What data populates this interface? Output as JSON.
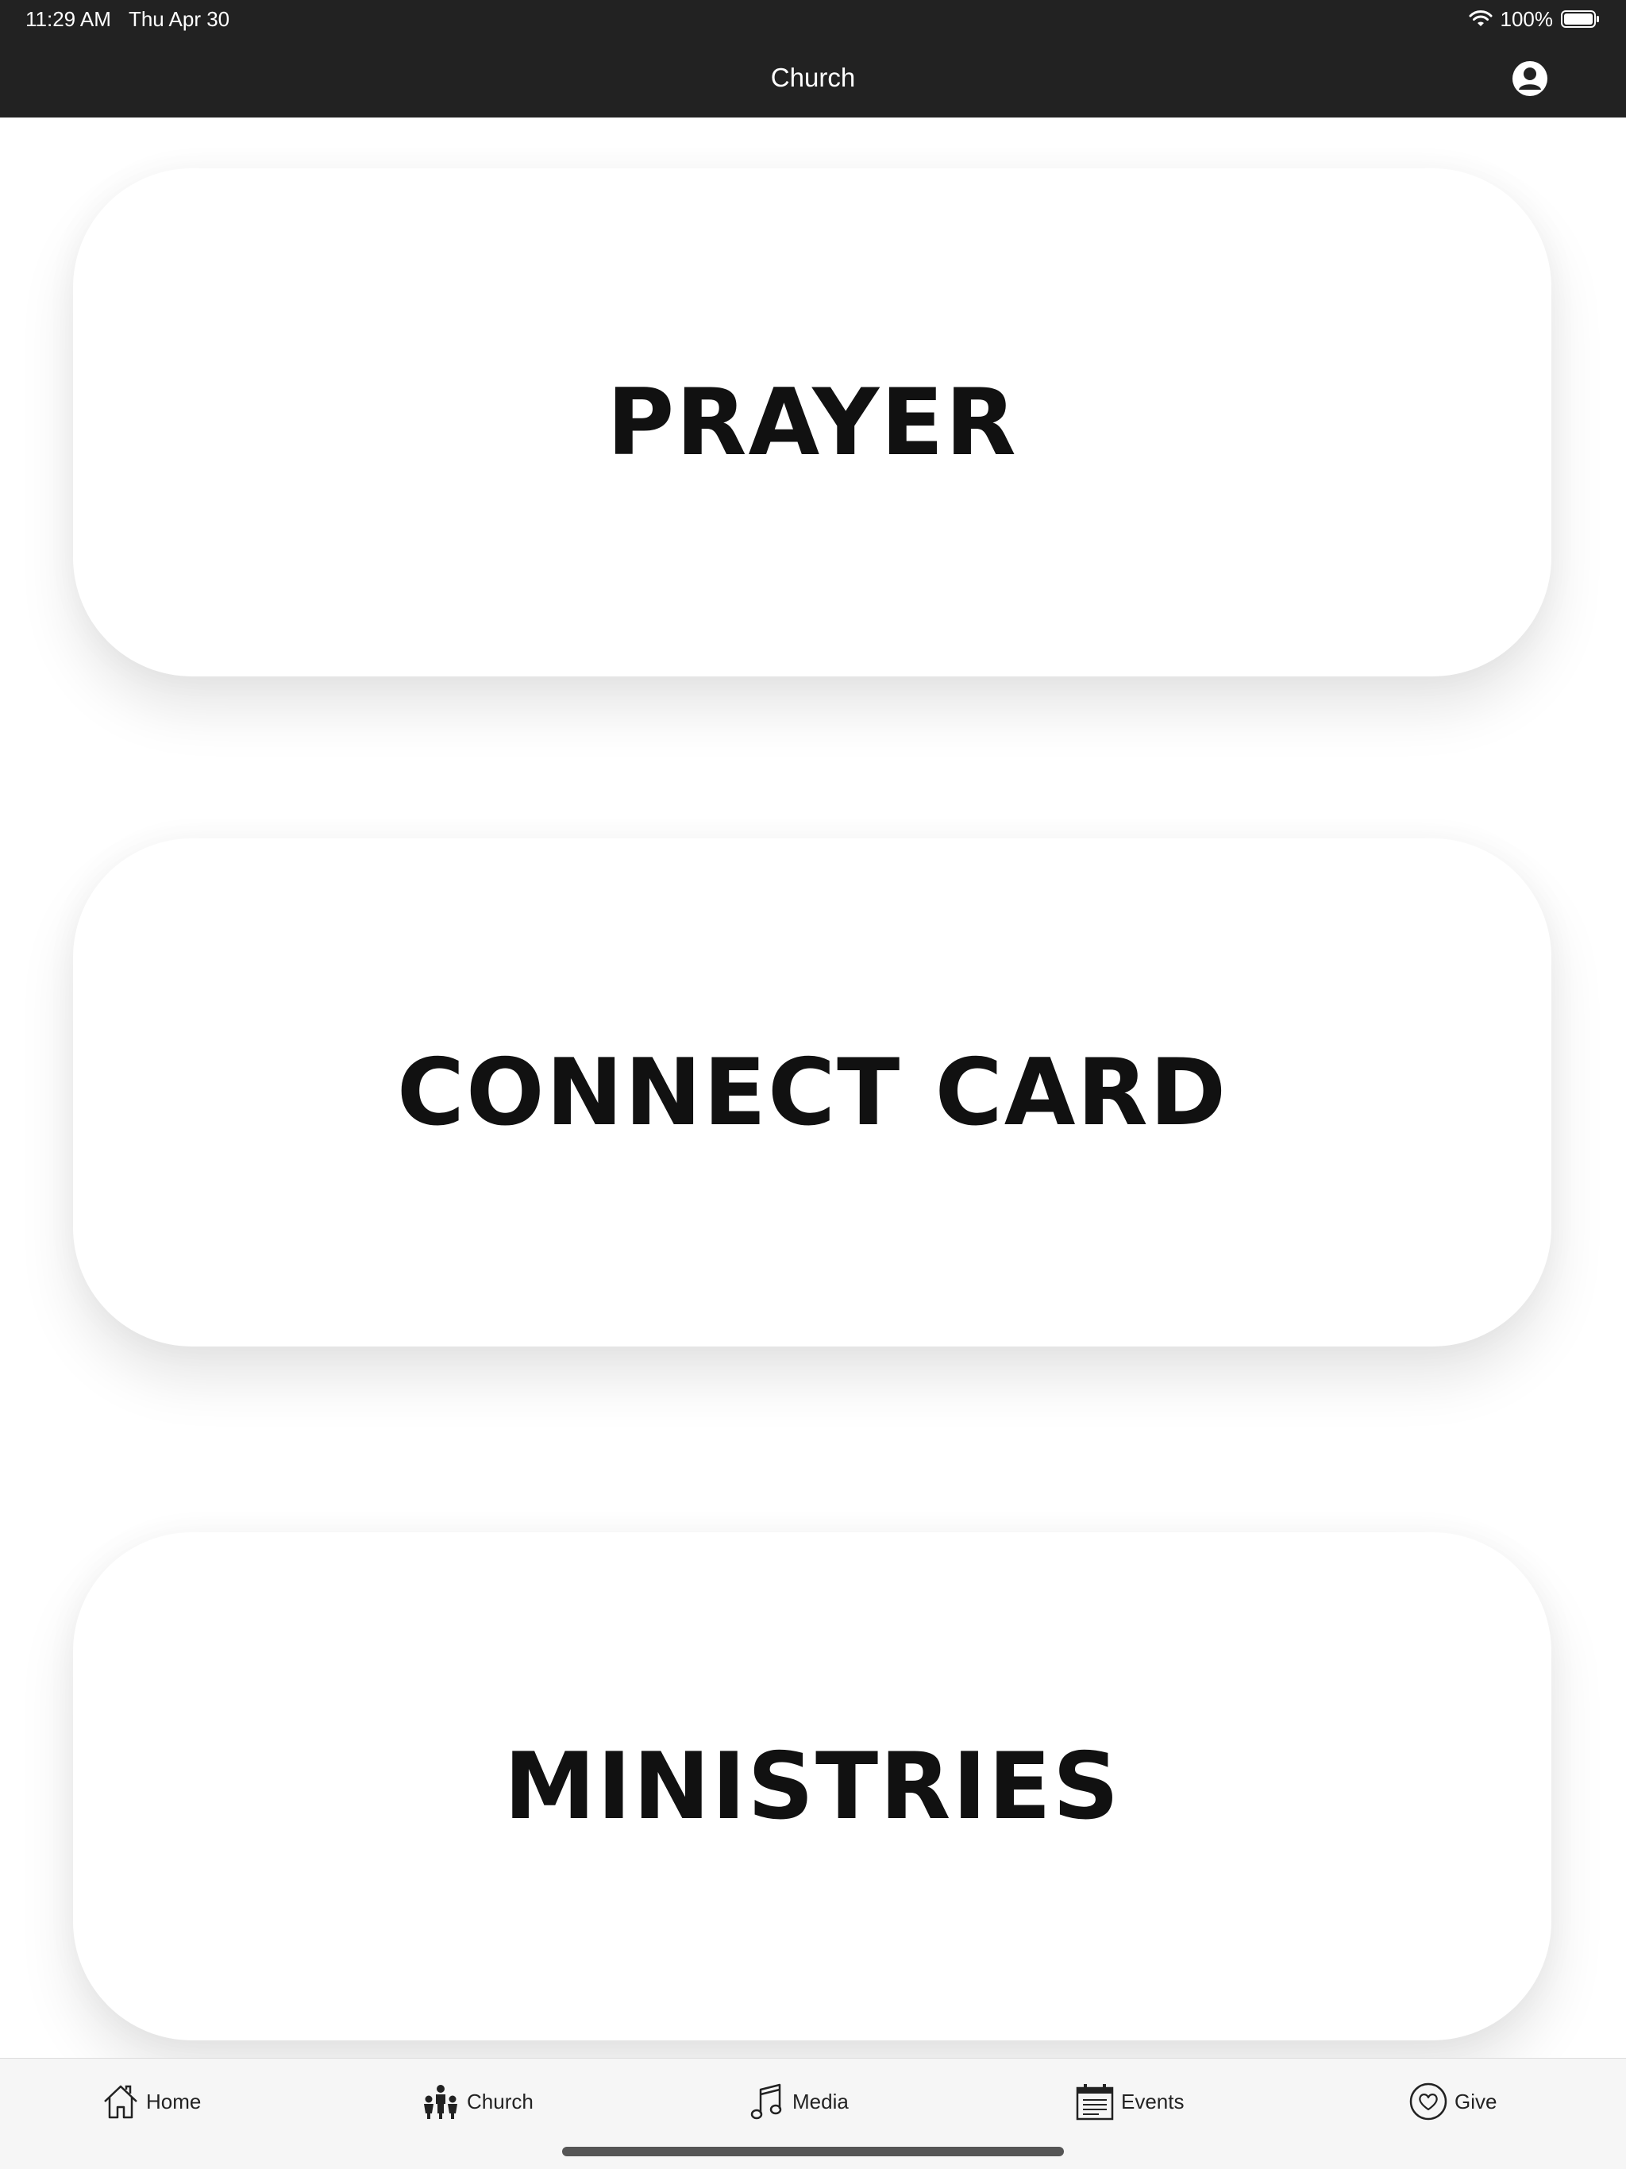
{
  "status_bar": {
    "time": "11:29 AM",
    "date": "Thu Apr 30",
    "battery_text": "100%",
    "icons": [
      "wifi-icon",
      "battery-icon"
    ]
  },
  "nav": {
    "title": "Church",
    "profile_icon": "profile-icon"
  },
  "cards": [
    {
      "label": "PRAYER"
    },
    {
      "label": "CONNECT CARD"
    },
    {
      "label": "MINISTRIES"
    }
  ],
  "tabbar": {
    "tabs": [
      {
        "label": "Home",
        "icon": "home-icon"
      },
      {
        "label": "Church",
        "icon": "church-people-icon"
      },
      {
        "label": "Media",
        "icon": "music-note-icon"
      },
      {
        "label": "Events",
        "icon": "calendar-icon"
      },
      {
        "label": "Give",
        "icon": "heart-icon"
      }
    ]
  },
  "colors": {
    "topbar_bg": "#222222",
    "content_bg": "#ffffff",
    "tabbar_bg": "#f6f6f6",
    "text_dark": "#111111"
  }
}
